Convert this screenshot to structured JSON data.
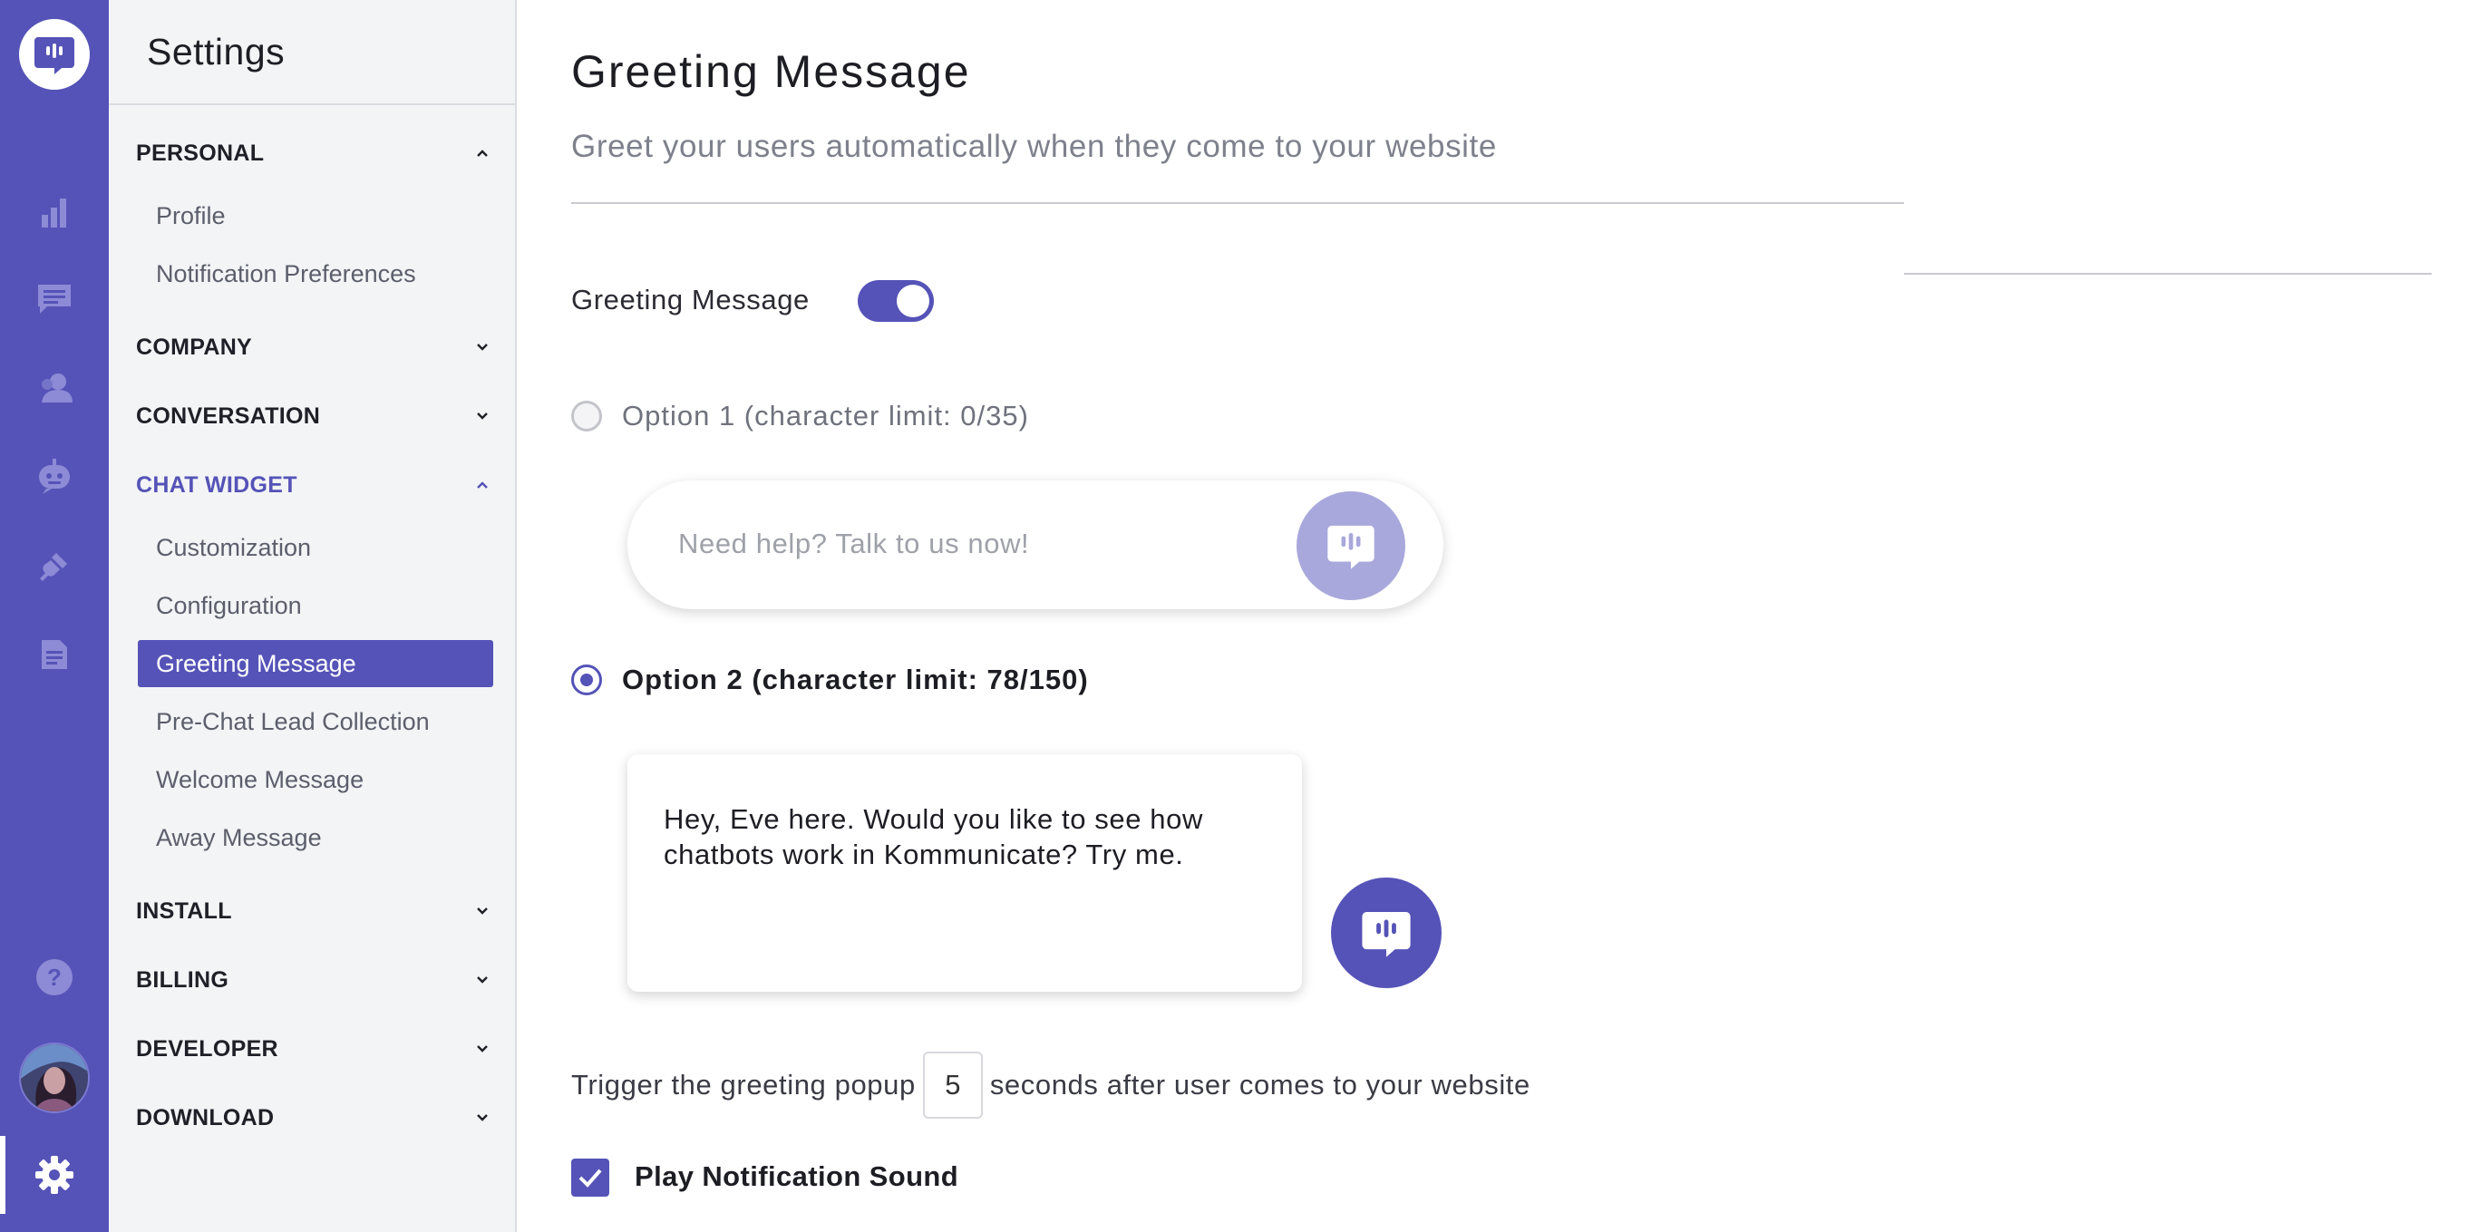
{
  "colors": {
    "accent": "#5553b7",
    "accent_light": "#a9a8dc",
    "sidebar_bg": "#f3f4f6",
    "text_dark": "#1d1d24",
    "text_muted": "#7e818c"
  },
  "rail": {
    "logo_icon": "chat-bubble-logo-icon",
    "items": [
      {
        "icon": "bar-chart-icon"
      },
      {
        "icon": "conversations-icon"
      },
      {
        "icon": "users-icon"
      },
      {
        "icon": "bot-icon"
      },
      {
        "icon": "integrations-icon"
      },
      {
        "icon": "reports-icon"
      },
      {
        "icon": "help-icon"
      },
      {
        "icon": "avatar"
      },
      {
        "icon": "settings-gear-icon",
        "active": true
      }
    ]
  },
  "sidebar": {
    "title": "Settings",
    "sections": {
      "personal": {
        "label": "PERSONAL",
        "expanded": true,
        "items": [
          "Profile",
          "Notification Preferences"
        ]
      },
      "company": {
        "label": "COMPANY",
        "expanded": false
      },
      "conversation": {
        "label": "CONVERSATION",
        "expanded": false
      },
      "chat_widget": {
        "label": "CHAT WIDGET",
        "expanded": true,
        "active": true,
        "items": [
          "Customization",
          "Configuration",
          "Greeting Message",
          "Pre-Chat Lead Collection",
          "Welcome Message",
          "Away Message"
        ],
        "selected": "Greeting Message"
      },
      "install": {
        "label": "INSTALL",
        "expanded": false
      },
      "billing": {
        "label": "BILLING",
        "expanded": false
      },
      "developer": {
        "label": "DEVELOPER",
        "expanded": false
      },
      "download": {
        "label": "DOWNLOAD",
        "expanded": false
      }
    }
  },
  "main": {
    "title": "Greeting Message",
    "subtitle": "Greet your users automatically when they come to your website",
    "toggle_label": "Greeting Message",
    "toggle_on": true,
    "option1": {
      "label": "Option 1 (character limit: 0/35)",
      "selected": false,
      "placeholder": "Need help? Talk to us now!",
      "value": ""
    },
    "option2": {
      "label": "Option 2 (character limit: 78/150)",
      "selected": true,
      "message": "Hey, Eve here. Would you like to see how chatbots work in Kommunicate? Try me."
    },
    "trigger": {
      "prefix": "Trigger the greeting popup",
      "seconds": "5",
      "suffix": "seconds after user comes to your website"
    },
    "notification_sound": {
      "label": "Play Notification Sound",
      "checked": true
    }
  }
}
